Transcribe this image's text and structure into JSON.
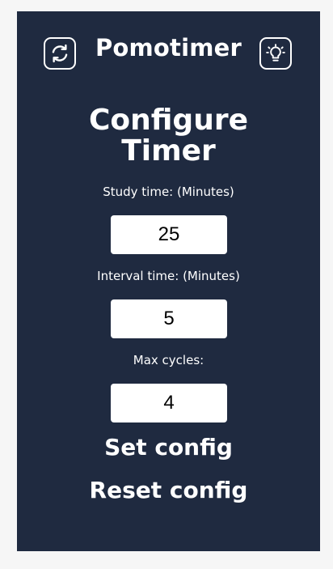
{
  "header": {
    "title": "Pomotimer",
    "left_icon": "refresh-icon",
    "right_icon": "lightbulb-icon"
  },
  "config": {
    "heading_line1": "Configure",
    "heading_line2": "Timer",
    "study_label": "Study time: (Minutes)",
    "study_value": "25",
    "interval_label": "Interval time: (Minutes)",
    "interval_value": "5",
    "cycles_label": "Max cycles:",
    "cycles_value": "4",
    "set_label": "Set config",
    "reset_label": "Reset config"
  },
  "colors": {
    "panel": "#1f2a40",
    "text": "#ffffff",
    "input_bg": "#ffffff",
    "page_bg": "#f6f6f6"
  }
}
